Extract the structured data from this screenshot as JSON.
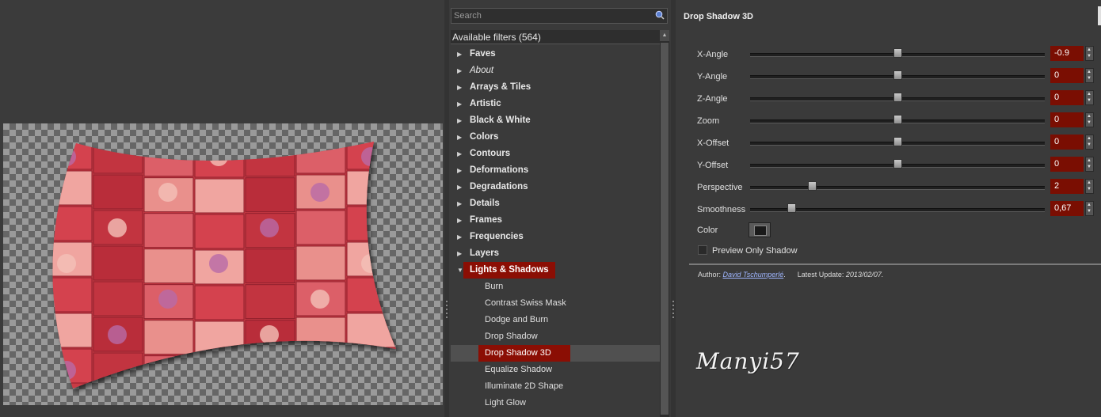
{
  "search": {
    "placeholder": "Search"
  },
  "filters_header": "Available filters (564)",
  "categories": [
    {
      "label": "Faves"
    },
    {
      "label": "About",
      "italic": true
    },
    {
      "label": "Arrays & Tiles"
    },
    {
      "label": "Artistic"
    },
    {
      "label": "Black & White"
    },
    {
      "label": "Colors"
    },
    {
      "label": "Contours"
    },
    {
      "label": "Deformations"
    },
    {
      "label": "Degradations"
    },
    {
      "label": "Details"
    },
    {
      "label": "Frames"
    },
    {
      "label": "Frequencies"
    },
    {
      "label": "Layers"
    },
    {
      "label": "Lights & Shadows",
      "expanded": true
    }
  ],
  "subitems": [
    {
      "label": "Burn"
    },
    {
      "label": "Contrast Swiss Mask"
    },
    {
      "label": "Dodge and Burn"
    },
    {
      "label": "Drop Shadow"
    },
    {
      "label": "Drop Shadow 3D",
      "selected": true
    },
    {
      "label": "Equalize Shadow"
    },
    {
      "label": "Illuminate 2D Shape"
    },
    {
      "label": "Light Glow"
    }
  ],
  "filter_title": "Drop Shadow 3D",
  "params": [
    {
      "label": "X-Angle",
      "value": "-0.9",
      "position": 0.5
    },
    {
      "label": "Y-Angle",
      "value": "0",
      "position": 0.5
    },
    {
      "label": "Z-Angle",
      "value": "0",
      "position": 0.5
    },
    {
      "label": "Zoom",
      "value": "0",
      "position": 0.5
    },
    {
      "label": "X-Offset",
      "value": "0",
      "position": 0.5
    },
    {
      "label": "Y-Offset",
      "value": "0",
      "position": 0.5
    },
    {
      "label": "Perspective",
      "value": "2",
      "position": 0.21
    },
    {
      "label": "Smoothness",
      "value": "0,67",
      "position": 0.14
    }
  ],
  "color": {
    "label": "Color",
    "value": "#1a1a1a"
  },
  "preview_only_shadow": {
    "label": "Preview Only Shadow",
    "checked": false
  },
  "author": {
    "prefix": "Author:",
    "name": "David Tschumperlé",
    "after_name": ".",
    "update_prefix": "Latest Update:",
    "update_date": "2013/02/07."
  },
  "signature": "Manyi57",
  "colors": {
    "accent": "#8b0e04",
    "background": "#3a3a3a",
    "value_box": "#7a0e02"
  },
  "icons": {
    "search": "search-icon",
    "expand": "triangle-right-icon",
    "collapse": "triangle-down-icon"
  }
}
